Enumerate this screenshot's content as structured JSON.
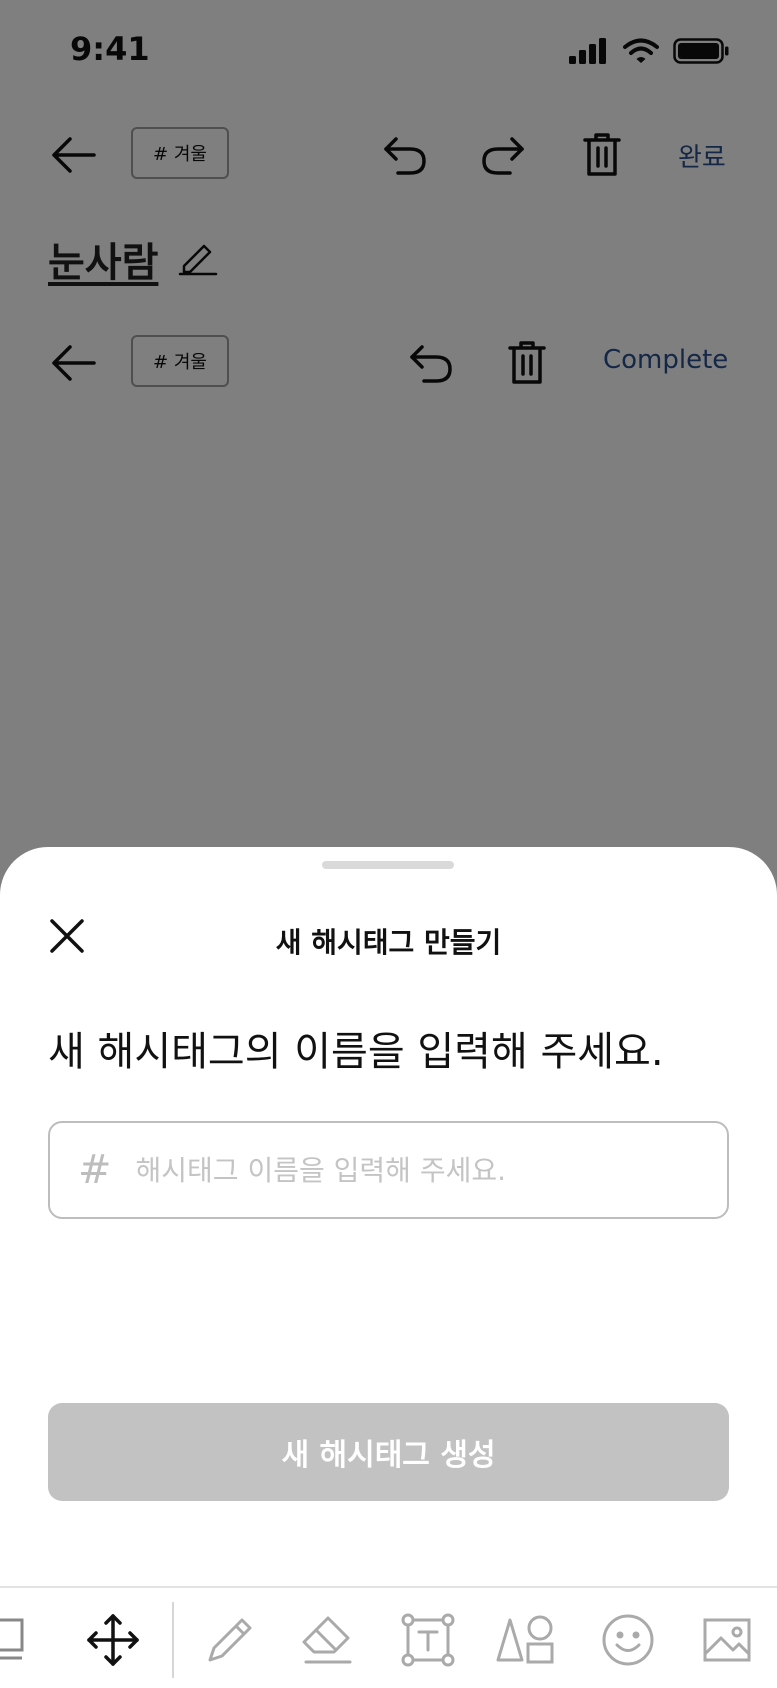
{
  "status_bar": {
    "time": "9:41"
  },
  "editor": {
    "row1": {
      "tag_label": "# 겨울",
      "done_label": "완료"
    },
    "title": "눈사람",
    "row2": {
      "tag_label": "# 겨울",
      "done_label": "Complete"
    }
  },
  "sheet": {
    "title": "새 해시태그 만들기",
    "prompt": "새 해시태그의 이름을 입력해 주세요.",
    "input": {
      "prefix": "#",
      "value": "",
      "placeholder": "해시태그 이름을 입력해 주세요."
    },
    "create_button": "새 해시태그 생성"
  },
  "bottom_toolbar": {
    "tools": [
      "square-icon",
      "move-icon",
      "pen-icon",
      "eraser-icon",
      "text-box-icon",
      "shapes-icon",
      "emoji-icon",
      "image-icon"
    ]
  },
  "colors": {
    "link": "#2b4f8f",
    "overlay": "rgba(0,0,0,0.5)",
    "disabled_button": "#c2c2c2"
  }
}
